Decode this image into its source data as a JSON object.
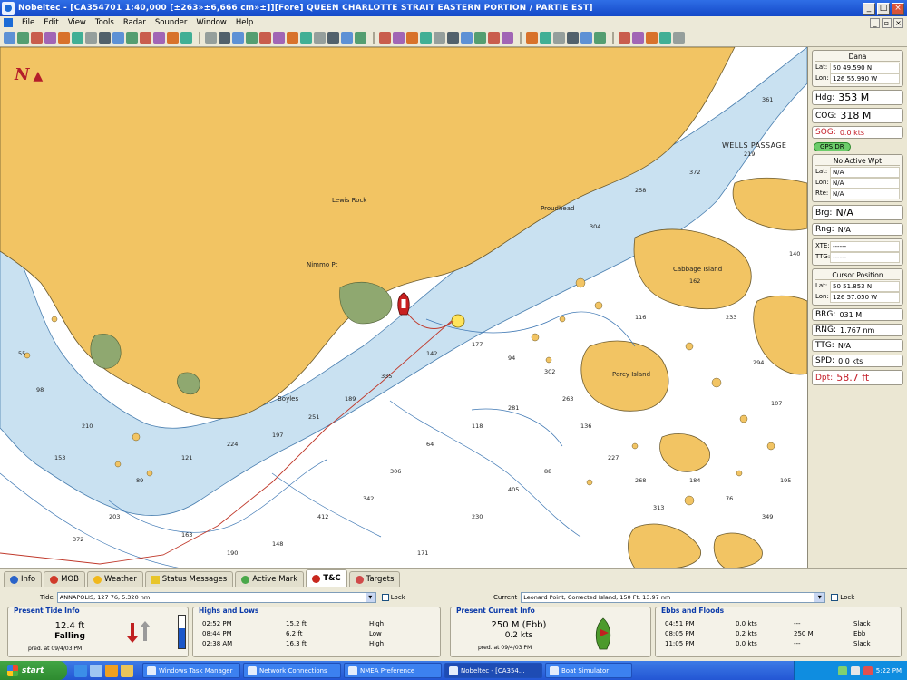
{
  "window": {
    "title": "Nobeltec - [CA354701 1:40,000 [±263»±6,666 cm»±]][Fore]  QUEEN CHARLOTTE STRAIT EASTERN PORTION / PARTIE EST]"
  },
  "menu": [
    "File",
    "Edit",
    "View",
    "Tools",
    "Radar",
    "Sounder",
    "Window",
    "Help"
  ],
  "chart": {
    "north_label": "N",
    "places": [
      "WELLS PASSAGE",
      "Percy Island",
      "Cabbage Island",
      "Boyles",
      "Proudhead",
      "Nimmo Pt",
      "Lewis Rock"
    ],
    "soundings": [
      "55",
      "98",
      "210",
      "153",
      "89",
      "121",
      "224",
      "197",
      "251",
      "189",
      "335",
      "142",
      "177",
      "94",
      "302",
      "263",
      "281",
      "118",
      "64",
      "306",
      "342",
      "412",
      "148",
      "190",
      "163",
      "203",
      "372",
      "171",
      "230",
      "405",
      "88",
      "136",
      "227",
      "268",
      "313",
      "184",
      "76",
      "349",
      "195",
      "107",
      "294",
      "233",
      "162",
      "116",
      "304",
      "258",
      "372",
      "219",
      "361",
      "140"
    ]
  },
  "panel": {
    "dest_header": "Dana",
    "dest_lat": "50 49.590 N",
    "dest_lon": "126 55.990 W",
    "hdg_label": "Hdg:",
    "hdg_value": "353 M",
    "cog_label": "COG:",
    "cog_value": "318 M",
    "sog_label": "SOG:",
    "sog_value": "0.0 kts",
    "gps_badge": "GPS DR",
    "waypoint_header": "No Active Wpt",
    "wpt_lat": "N/A",
    "wpt_lon": "N/A",
    "wpt_rte": "N/A",
    "brg_label": "Brg:",
    "brg_value": "N/A",
    "rng_label": "Rng:",
    "rng_value": "N/A",
    "xte_label": "XTE:",
    "xte_value": "------",
    "ttg_label": "TTG:",
    "ttg_value": "------",
    "cursor_header": "Cursor Position",
    "cur_lat": "50 51.853 N",
    "cur_lon": "126 57.050 W",
    "brg2_label": "BRG:",
    "brg2_value": "031 M",
    "rng2_label": "RNG:",
    "rng2_value": "1.767 nm",
    "ttg2_label": "TTG:",
    "ttg2_value": "N/A",
    "spd_label": "SPD:",
    "spd_value": "0.0 kts",
    "dpt_label": "Dpt:",
    "dpt_value": "58.7 ft"
  },
  "tabs": [
    "Info",
    "MOB",
    "Weather",
    "Status Messages",
    "Active Mark",
    "T&C",
    "Targets"
  ],
  "tide": {
    "tide_label": "Tide",
    "tide_select": "ANNAPOLIS, 127 76, 5.320 nm",
    "lock": "Lock",
    "current_label": "Current",
    "current_select": "Leonard Point, Corrected Island, 150 Ft, 13.97 nm",
    "present_tide_title": "Present Tide Info",
    "tide_height": "12.4 ft",
    "tide_state": "Falling",
    "tide_pred": "pred. at 09/4/03 PM",
    "highs_lows_title": "Highs and Lows",
    "highs_lows": [
      [
        "02:52 PM",
        "15.2 ft",
        "High"
      ],
      [
        "08:44 PM",
        "6.2 ft",
        "Low"
      ],
      [
        "02:38 AM",
        "16.3 ft",
        "High"
      ]
    ],
    "present_current_title": "Present Current Info",
    "current_speed": "250 M (Ebb)",
    "current_kts": "0.2 kts",
    "current_pred": "pred. at 09/4/03 PM",
    "ebbs_floods_title": "Ebbs and Floods",
    "ebbs_floods": [
      [
        "04:51 PM",
        "0.0 kts",
        "---",
        "Slack"
      ],
      [
        "08:05 PM",
        "0.2 kts",
        "250 M",
        "Ebb"
      ],
      [
        "11:05 PM",
        "0.0 kts",
        "---",
        "Slack"
      ]
    ]
  },
  "taskbar": {
    "start": "start",
    "tasks": [
      "Windows Task Manager",
      "Network Connections",
      "NMEA Preference",
      "Nobeltec - [CA354...",
      "Boat Simulator"
    ],
    "clock": "5:22 PM"
  },
  "colors": {
    "land": "#f2c463",
    "shoal": "#b9d8ee",
    "water": "#ffffff",
    "route": "#c0392b",
    "accent": "#1449c8"
  }
}
